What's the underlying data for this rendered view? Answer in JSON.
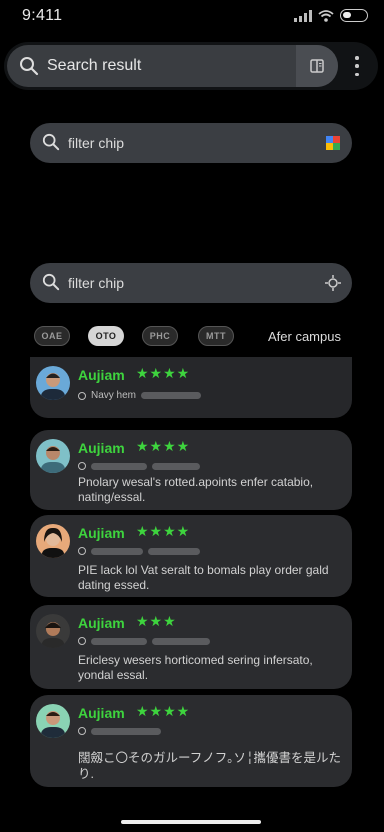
{
  "status_bar": {
    "time": "9:411"
  },
  "top_search": {
    "placeholder": "Search result"
  },
  "filter_search_1": {
    "text": "filter chip"
  },
  "filter_search_2": {
    "text": "filter chip"
  },
  "chips": [
    "OAE",
    "OTO",
    "PHC",
    "MTT"
  ],
  "after_campus": "Afer campus",
  "reviews": [
    {
      "name": "Aujiam",
      "stars": "★★★★",
      "meta": "Navy hem",
      "text": ""
    },
    {
      "name": "Aujiam",
      "stars": "★★★★",
      "meta": "",
      "text": "Pnolary wesal's rotted.apoints enfer catabio, nating/essal."
    },
    {
      "name": "Aujiam",
      "stars": "★★★★",
      "meta": "",
      "text": "PIE lack lol Vat seralt to bomals play order gald dating essed."
    },
    {
      "name": "Aujiam",
      "stars": "★★★",
      "meta": "",
      "text": "Ericlesy wesers horticomed sering infersato, yondal essal."
    },
    {
      "name": "Aujiam",
      "stars": "★★★★",
      "meta": "",
      "text": "闊劔こ〇そのガルーフノフ｡ソ╎攜優書を是ルたり."
    }
  ],
  "colors": {
    "accent_green": "#3ed43e",
    "card_bg": "#2b2c2f",
    "search_bg": "#3b3e43"
  }
}
